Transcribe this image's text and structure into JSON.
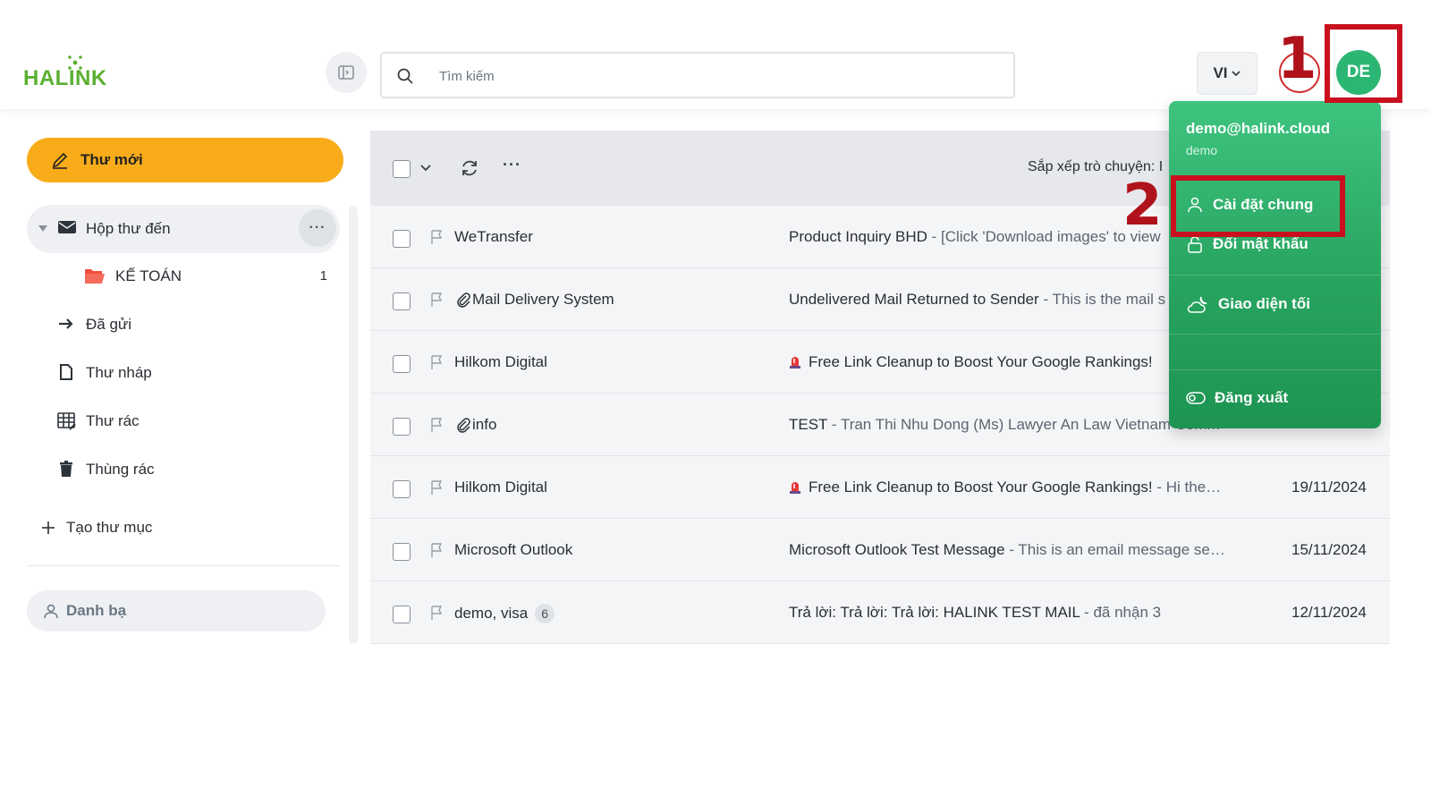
{
  "header": {
    "logo_text": "HALINK",
    "search_placeholder": "Tìm kiếm",
    "language": "VI",
    "avatar_initials": "DE"
  },
  "annotations": {
    "step1": "1",
    "step2": "2"
  },
  "user_menu": {
    "email": "demo@halink.cloud",
    "username": "demo",
    "items": [
      {
        "label": "Cài đặt chung",
        "icon": "user-icon"
      },
      {
        "label": "Đổi mật khẩu",
        "icon": "lock-icon"
      },
      {
        "label": "Giao diện tối",
        "icon": "cloud-moon-icon"
      },
      {
        "label": "Đăng xuất",
        "icon": "toggle-icon"
      }
    ]
  },
  "sidebar": {
    "compose_label": "Thư mới",
    "inbox_label": "Hộp thư đến",
    "inbox_more": "···",
    "folders": [
      {
        "label": "KẾ TOÁN",
        "count": "1"
      }
    ],
    "items": [
      {
        "label": "Đã gửi",
        "icon": "arrow-right-icon"
      },
      {
        "label": "Thư nháp",
        "icon": "document-icon"
      },
      {
        "label": "Thư rác",
        "icon": "spam-icon"
      },
      {
        "label": "Thùng rác",
        "icon": "trash-icon"
      }
    ],
    "create_folder": "Tạo thư mục",
    "contacts": "Danh bạ"
  },
  "toolbar": {
    "more": "···",
    "sort_label": "Sắp xếp trò chuyện: I"
  },
  "emails": [
    {
      "sender": "WeTransfer",
      "attachment": false,
      "subject": "Product Inquiry BHD",
      "preview": " - [Click 'Download images' to view",
      "date": ""
    },
    {
      "sender": "Mail Delivery System",
      "attachment": true,
      "subject": "Undelivered Mail Returned to Sender",
      "preview": " - This is the mail s",
      "date": ""
    },
    {
      "sender": "Hilkom Digital",
      "attachment": false,
      "emoji": true,
      "subject": "Free Link Cleanup to Boost Your Google Rankings!",
      "preview": "",
      "date": ""
    },
    {
      "sender": "info",
      "attachment": true,
      "subject": "TEST",
      "preview": " - Tran Thi Nhu Dong (Ms) Lawyer An Law Vietnam Comm",
      "date": ""
    },
    {
      "sender": "Hilkom Digital",
      "attachment": false,
      "emoji": true,
      "subject": "Free Link Cleanup to Boost Your Google Rankings!",
      "preview": " - Hi the…",
      "date": "19/11/2024"
    },
    {
      "sender": "Microsoft Outlook",
      "attachment": false,
      "subject": "Microsoft Outlook Test Message",
      "preview": " - This is an email message se…",
      "date": "15/11/2024"
    },
    {
      "sender": "demo,  visa",
      "attachment": false,
      "badge": "6",
      "subject": "Trả lời: Trả lời: Trả lời: HALINK TEST MAIL",
      "preview": " - đã nhận 3",
      "date": "12/11/2024"
    }
  ],
  "colors": {
    "brand_green": "#5ab031",
    "compose_orange": "#f9ac19",
    "menu_green": "#27a460",
    "annotation_red": "#c8101e"
  }
}
